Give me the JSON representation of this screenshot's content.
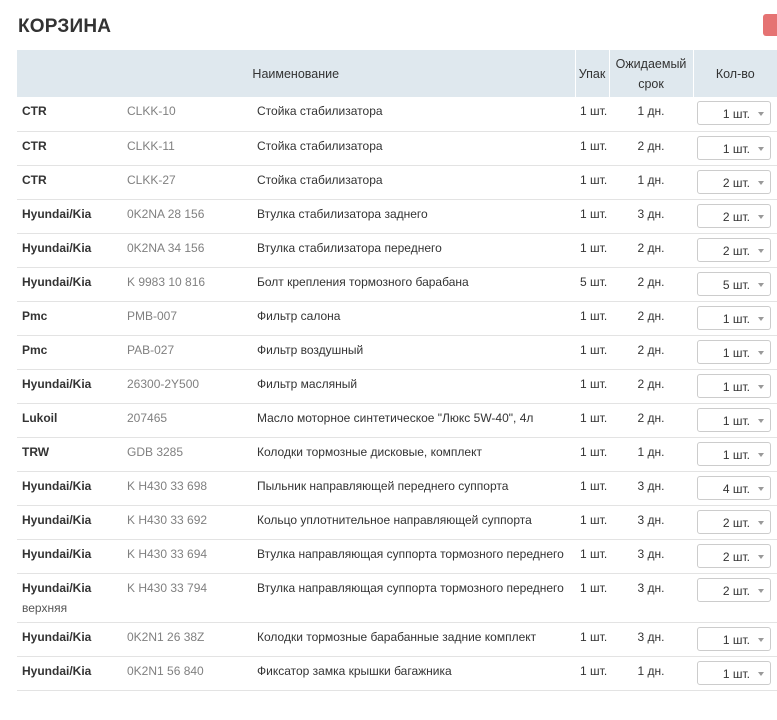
{
  "page": {
    "title": "КОРЗИНА"
  },
  "colors": {
    "header_bg": "#dfe8ee",
    "accent_button": "#e57373",
    "article_text": "#808080"
  },
  "table": {
    "headers": {
      "name": "Наименование",
      "pack": "Упак",
      "term_line1": "Ожидаемый",
      "term_line2": "срок",
      "qty": "Кол-во"
    },
    "rows": [
      {
        "brand": "CTR",
        "brand_extra": "",
        "article": "CLKK-10",
        "name": "Стойка стабилизатора",
        "pack": "1 шт.",
        "term": "1 дн.",
        "qty": "1 шт."
      },
      {
        "brand": "CTR",
        "brand_extra": "",
        "article": "CLKK-11",
        "name": "Стойка стабилизатора",
        "pack": "1 шт.",
        "term": "2 дн.",
        "qty": "1 шт."
      },
      {
        "brand": "CTR",
        "brand_extra": "",
        "article": "CLKK-27",
        "name": "Стойка стабилизатора",
        "pack": "1 шт.",
        "term": "1 дн.",
        "qty": "2 шт."
      },
      {
        "brand": "Hyundai/Kia",
        "brand_extra": "",
        "article": "0K2NA 28 156",
        "name": "Втулка стабилизатора заднего",
        "pack": "1 шт.",
        "term": "3 дн.",
        "qty": "2 шт."
      },
      {
        "brand": "Hyundai/Kia",
        "brand_extra": "",
        "article": "0K2NA 34 156",
        "name": "Втулка стабилизатора переднего",
        "pack": "1 шт.",
        "term": "2 дн.",
        "qty": "2 шт."
      },
      {
        "brand": "Hyundai/Kia",
        "brand_extra": "",
        "article": "K 9983 10 816",
        "name": "Болт крепления тормозного барабана",
        "pack": "5 шт.",
        "term": "2 дн.",
        "qty": "5 шт."
      },
      {
        "brand": "Pmc",
        "brand_extra": "",
        "article": "PMB-007",
        "name": "Фильтр салона",
        "pack": "1 шт.",
        "term": "2 дн.",
        "qty": "1 шт."
      },
      {
        "brand": "Pmc",
        "brand_extra": "",
        "article": "PAB-027",
        "name": "Фильтр воздушный",
        "pack": "1 шт.",
        "term": "2 дн.",
        "qty": "1 шт."
      },
      {
        "brand": "Hyundai/Kia",
        "brand_extra": "",
        "article": "26300-2Y500",
        "name": "Фильтр масляный",
        "pack": "1 шт.",
        "term": "2 дн.",
        "qty": "1 шт."
      },
      {
        "brand": "Lukoil",
        "brand_extra": "",
        "article": "207465",
        "name": "Масло моторное синтетическое \"Люкс 5W-40\", 4л",
        "pack": "1 шт.",
        "term": "2 дн.",
        "qty": "1 шт."
      },
      {
        "brand": "TRW",
        "brand_extra": "",
        "article": "GDB 3285",
        "name": "Колодки тормозные дисковые, комплект",
        "pack": "1 шт.",
        "term": "1 дн.",
        "qty": "1 шт."
      },
      {
        "brand": "Hyundai/Kia",
        "brand_extra": "",
        "article": "K H430 33 698",
        "name": "Пыльник направляющей переднего суппорта",
        "pack": "1 шт.",
        "term": "3 дн.",
        "qty": "4 шт."
      },
      {
        "brand": "Hyundai/Kia",
        "brand_extra": "",
        "article": "K H430 33 692",
        "name": "Кольцо уплотнительное направляющей суппорта",
        "pack": "1 шт.",
        "term": "3 дн.",
        "qty": "2 шт."
      },
      {
        "brand": "Hyundai/Kia",
        "brand_extra": "",
        "article": "K H430 33 694",
        "name": "Втулка направляющая суппорта тормозного переднего",
        "pack": "1 шт.",
        "term": "3 дн.",
        "qty": "2 шт."
      },
      {
        "brand": "Hyundai/Kia",
        "brand_extra": "верхняя",
        "article": "K H430 33 794",
        "name": "Втулка направляющая суппорта тормозного переднего",
        "pack": "1 шт.",
        "term": "3 дн.",
        "qty": "2 шт."
      },
      {
        "brand": "Hyundai/Kia",
        "brand_extra": "",
        "article": "0K2N1 26 38Z",
        "name": "Колодки тормозные барабанные задние комплект",
        "pack": "1 шт.",
        "term": "3 дн.",
        "qty": "1 шт."
      },
      {
        "brand": "Hyundai/Kia",
        "brand_extra": "",
        "article": "0K2N1 56 840",
        "name": "Фиксатор замка крышки багажника",
        "pack": "1 шт.",
        "term": "1 дн.",
        "qty": "1 шт."
      }
    ]
  }
}
